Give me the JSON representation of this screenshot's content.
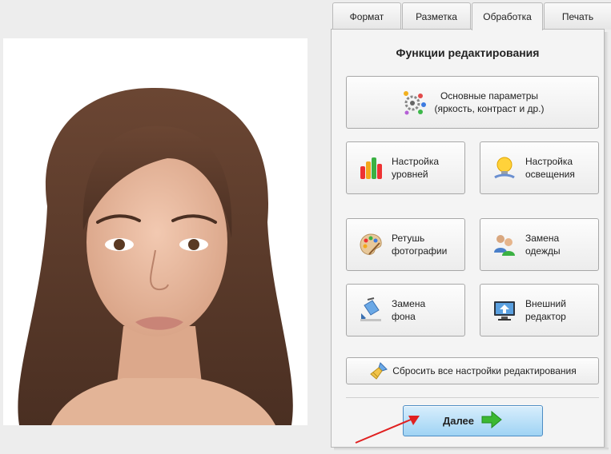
{
  "tabs": [
    {
      "label": "Формат"
    },
    {
      "label": "Разметка"
    },
    {
      "label": "Обработка"
    },
    {
      "label": "Печать"
    }
  ],
  "active_tab": "Обработка",
  "panel": {
    "title": "Функции редактирования",
    "buttons": {
      "basic": {
        "label": "Основные параметры\n(яркость, контраст и др.)",
        "icon": "gears-icon"
      },
      "levels": {
        "label": "Настройка\nуровней",
        "icon": "bar-chart-icon"
      },
      "lighting": {
        "label": "Настройка\nосвещения",
        "icon": "lightbulb-icon"
      },
      "retouch": {
        "label": "Ретушь\nфотографии",
        "icon": "palette-icon"
      },
      "clothes": {
        "label": "Замена\nодежды",
        "icon": "people-icon"
      },
      "background": {
        "label": "Замена\nфона",
        "icon": "paint-bucket-icon"
      },
      "external": {
        "label": "Внешний\nредактор",
        "icon": "monitor-upload-icon"
      }
    },
    "reset_label": "Сбросить все настройки редактирования",
    "next_label": "Далее"
  },
  "colors": {
    "next_button": "#9fd3f4",
    "annotation_arrow": "#e02020",
    "next_arrow": "#3cb832"
  }
}
